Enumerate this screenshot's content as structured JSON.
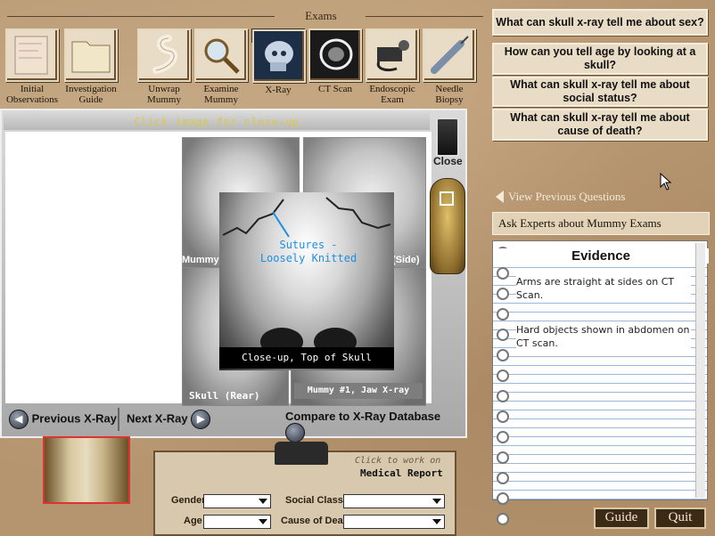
{
  "exams": {
    "title": "Exams",
    "tools": [
      {
        "label": "Initial Observations",
        "icon": "notes-paper-icon"
      },
      {
        "label": "Investigation Guide",
        "icon": "folder-icon"
      },
      {
        "label": "Unwrap Mummy",
        "icon": "bandage-icon"
      },
      {
        "label": "Examine Mummy",
        "icon": "magnifier-icon"
      },
      {
        "label": "X-Ray",
        "icon": "xray-skull-icon"
      },
      {
        "label": "CT Scan",
        "icon": "ct-skull-icon"
      },
      {
        "label": "Endoscopic Exam",
        "icon": "endoscope-icon"
      },
      {
        "label": "Needle Biopsy",
        "icon": "syringe-icon"
      }
    ]
  },
  "viewer": {
    "hint": "Click image for close-up.",
    "close_label": "Close",
    "labels": {
      "mummy_partial": "Mummy",
      "side_partial": "(Side)",
      "skull_rear": "Skull (Rear)",
      "jaw_xray": "Mummy #1, Jaw X-ray"
    },
    "closeup": {
      "annotation": "Sutures -\nLoosely Knitted",
      "caption": "Close-up, Top of Skull"
    },
    "nav": {
      "previous": "Previous X-Ray",
      "next": "Next X-Ray",
      "compare": "Compare to X-Ray Database"
    }
  },
  "questions": [
    "What can skull x-ray tell me about sex?",
    "How can you tell age by looking at a skull?",
    "What can skull x-ray tell me about social status?",
    "What can skull x-ray tell me about cause of death?"
  ],
  "view_previous": "View Previous Questions",
  "ask_experts": "Ask Experts about Mummy Exams",
  "evidence": {
    "title": "Evidence",
    "entries": [
      "Arms are straight at sides on CT Scan.",
      "Hard objects shown in abdomen on CT scan."
    ]
  },
  "report": {
    "hint": "Click to work on",
    "title": "Medical Report",
    "fields": {
      "gender": "Gender",
      "age": "Age",
      "social_class": "Social Class",
      "cause_of_death": "Cause of Death"
    }
  },
  "buttons": {
    "guide": "Guide",
    "quit": "Quit"
  }
}
